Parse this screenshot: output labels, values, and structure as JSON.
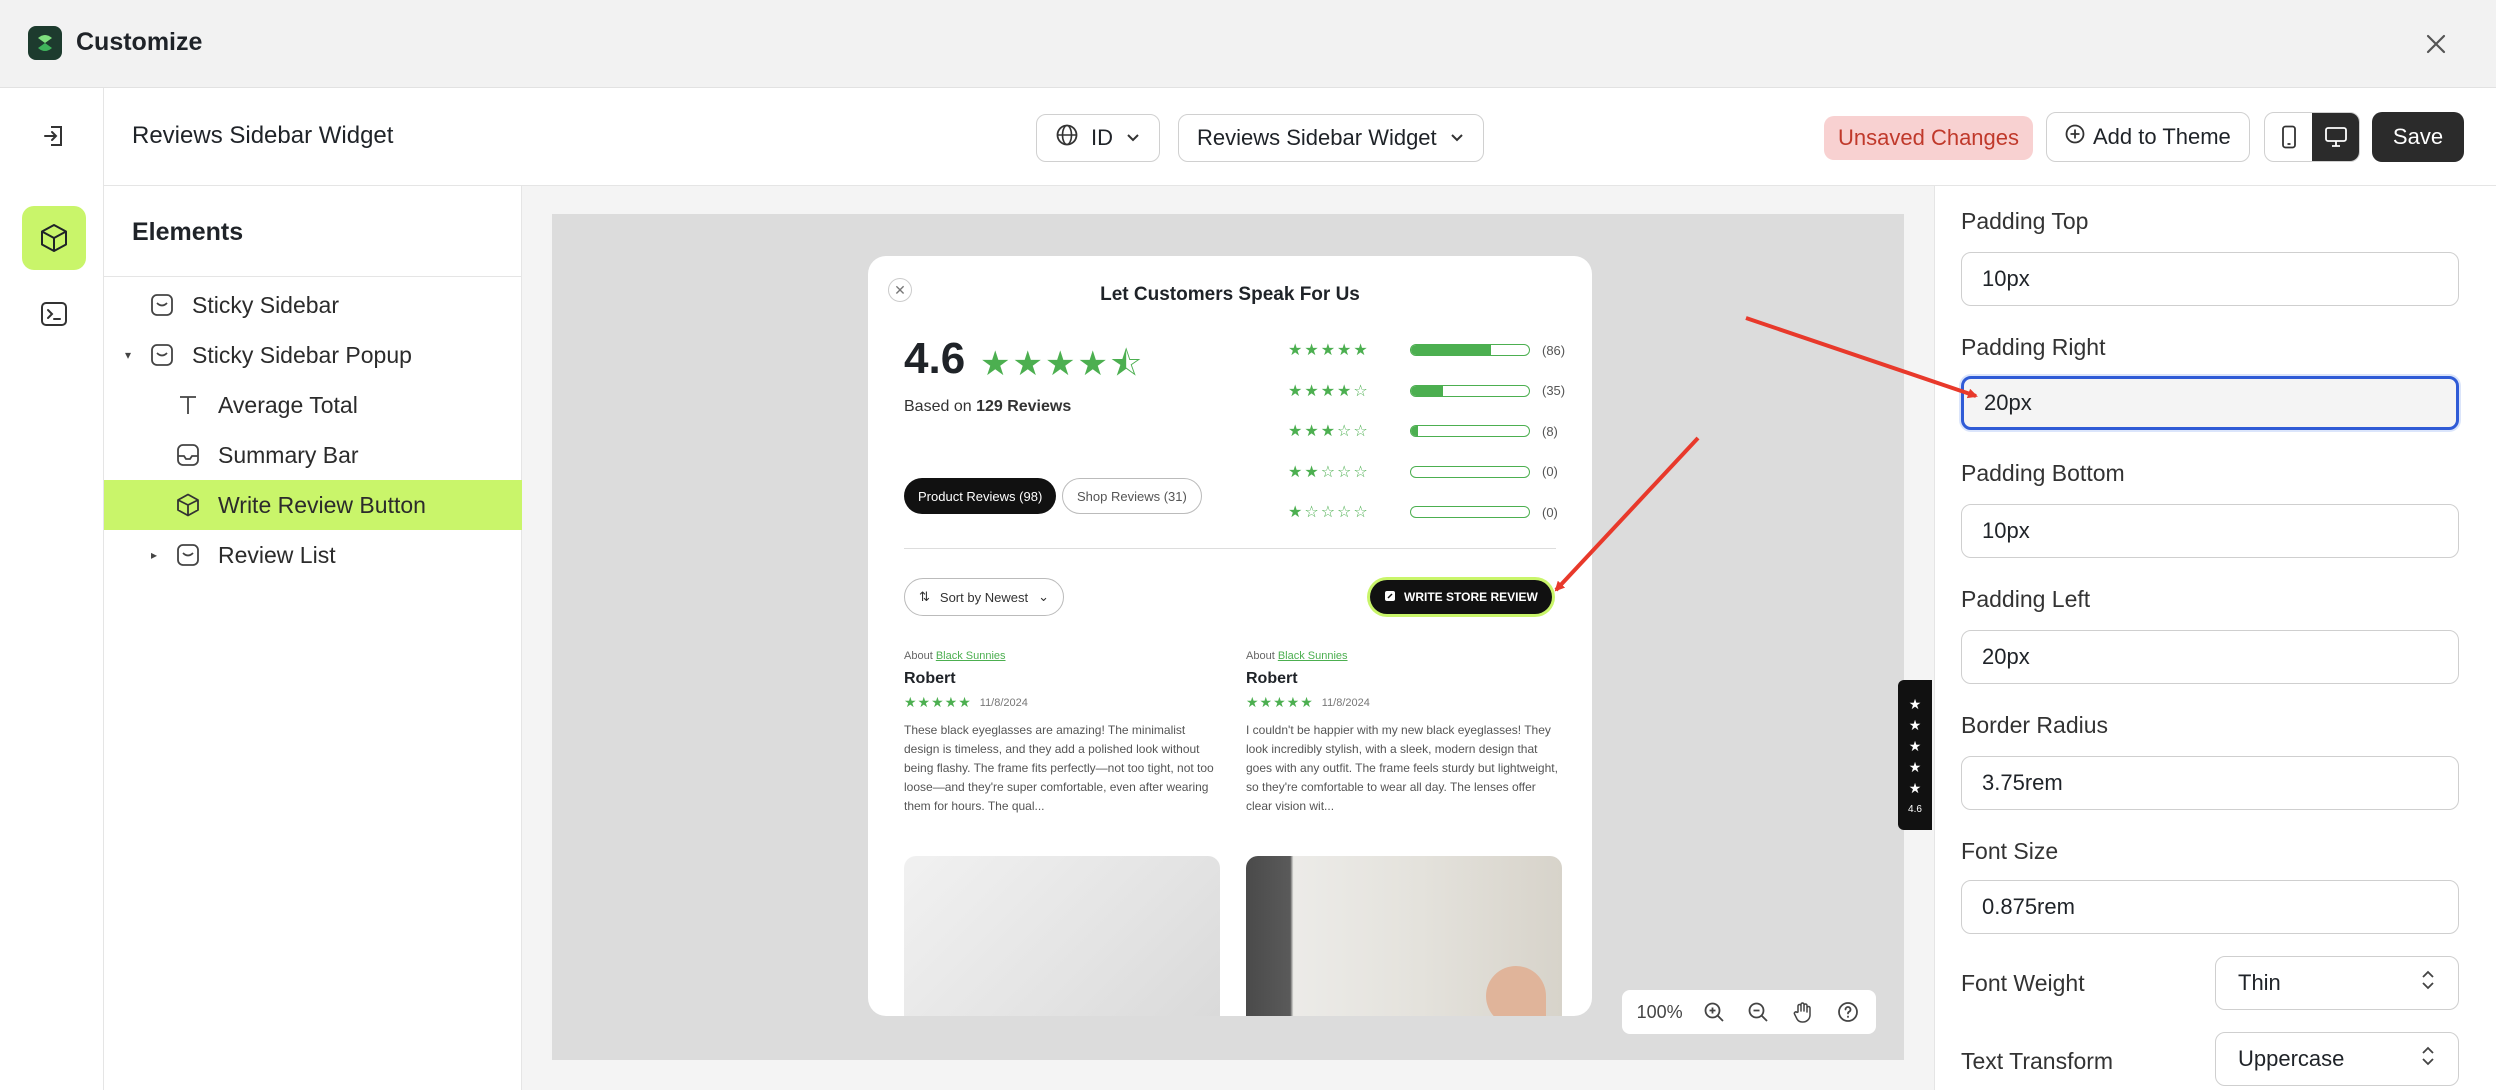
{
  "app": {
    "title": "Customize"
  },
  "toolbar": {
    "page_name": "Reviews Sidebar Widget",
    "language": "ID",
    "template": "Reviews Sidebar Widget",
    "unsaved": "Unsaved Changes",
    "add_to_theme": "Add to Theme",
    "save": "Save"
  },
  "elements": {
    "title": "Elements",
    "items": [
      {
        "label": "Sticky Sidebar",
        "icon": "sidebar-icon"
      },
      {
        "label": "Sticky Sidebar Popup",
        "icon": "sidebar-icon"
      },
      {
        "label": "Average Total",
        "icon": "text-icon"
      },
      {
        "label": "Summary Bar",
        "icon": "section-icon"
      },
      {
        "label": "Write Review Button",
        "icon": "cube-icon"
      },
      {
        "label": "Review List",
        "icon": "sidebar-icon"
      }
    ]
  },
  "preview": {
    "title": "Let Customers Speak For Us",
    "average": "4.6",
    "based_prefix": "Based on",
    "based_count": "129 Reviews",
    "bars": [
      {
        "stars": "★★★★★",
        "fill": 0.68,
        "count": "(86)"
      },
      {
        "stars": "★★★★☆",
        "fill": 0.27,
        "count": "(35)"
      },
      {
        "stars": "★★★☆☆",
        "fill": 0.06,
        "count": "(8)"
      },
      {
        "stars": "★★☆☆☆",
        "fill": 0,
        "count": "(0)"
      },
      {
        "stars": "★☆☆☆☆",
        "fill": 0,
        "count": "(0)"
      }
    ],
    "tab_product": "Product Reviews (98)",
    "tab_shop": "Shop Reviews (31)",
    "sort": "Sort by Newest",
    "write_button": "WRITE STORE REVIEW",
    "reviews": [
      {
        "about_prefix": "About",
        "about_link": "Black Sunnies",
        "name": "Robert",
        "date": "11/8/2024",
        "body": "These black eyeglasses are amazing! The minimalist design is timeless, and they add a polished look without being flashy. The frame fits perfectly—not too tight, not too loose—and they're super comfortable, even after wearing them for hours. The qual..."
      },
      {
        "about_prefix": "About",
        "about_link": "Black Sunnies",
        "name": "Robert",
        "date": "11/8/2024",
        "body": "I couldn't be happier with my new black eyeglasses! They look incredibly stylish, with a sleek, modern design that goes with any outfit. The frame feels sturdy but lightweight, so they're comfortable to wear all day. The lenses offer clear vision wit..."
      }
    ],
    "side_tab_rating": "4.6",
    "zoom": "100%"
  },
  "properties": {
    "padding_top": {
      "label": "Padding Top",
      "value": "10px"
    },
    "padding_right": {
      "label": "Padding Right",
      "value": "20px"
    },
    "padding_bottom": {
      "label": "Padding Bottom",
      "value": "10px"
    },
    "padding_left": {
      "label": "Padding Left",
      "value": "20px"
    },
    "border_radius": {
      "label": "Border Radius",
      "value": "3.75rem"
    },
    "font_size": {
      "label": "Font Size",
      "value": "0.875rem"
    },
    "font_weight": {
      "label": "Font Weight",
      "value": "Thin"
    },
    "text_transform": {
      "label": "Text Transform",
      "value": "Uppercase"
    }
  },
  "colors": {
    "accent": "#c9f56a",
    "star": "#4caf50",
    "focus": "#2f5bd6",
    "unsaved_bg": "#f8d1d1",
    "unsaved_text": "#c0392b",
    "annotation": "#e8392b"
  }
}
